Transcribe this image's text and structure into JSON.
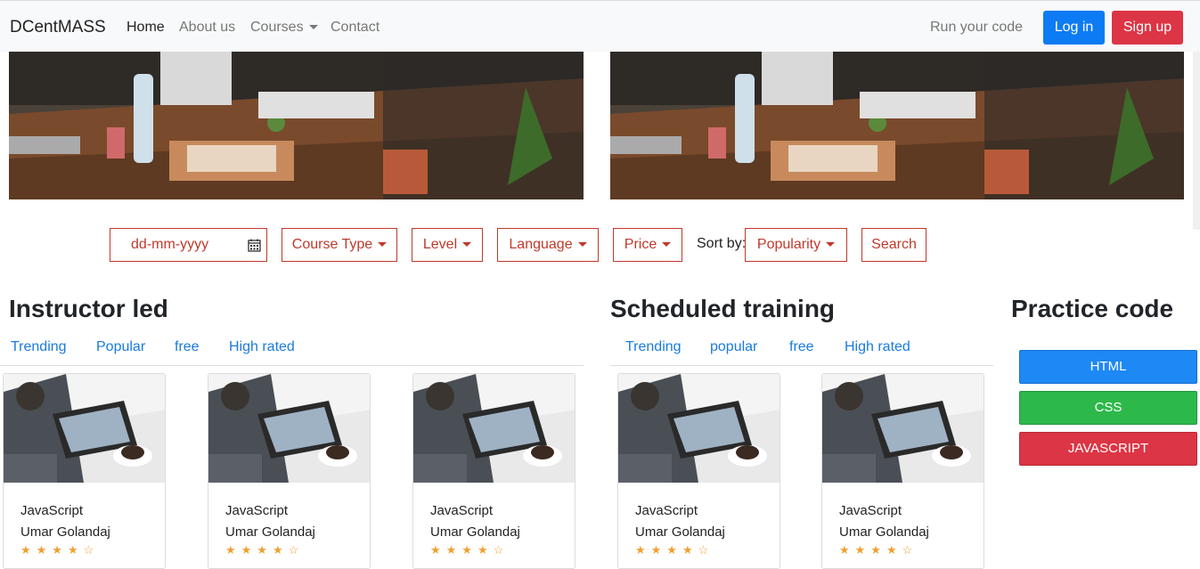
{
  "navbar": {
    "brand": "DCentMASS",
    "links": [
      {
        "label": "Home"
      },
      {
        "label": "About us"
      },
      {
        "label": "Courses"
      },
      {
        "label": "Contact"
      }
    ],
    "run_code": "Run your code",
    "login": "Log in",
    "signup": "Sign up"
  },
  "filters": {
    "date_placeholder": "dd-mm-yyyy",
    "course_type": "Course Type",
    "level": "Level",
    "language": "Language",
    "price": "Price",
    "sort_label": "Sort by:",
    "sort_value": "Popularity",
    "search": "Search"
  },
  "instructor": {
    "heading": "Instructor led",
    "tabs": [
      "Trending",
      "Popular",
      "free",
      "High rated"
    ],
    "cards": [
      {
        "title": "JavaScript",
        "author": "Umar Golandaj",
        "rating": 4
      },
      {
        "title": "JavaScript",
        "author": "Umar Golandaj",
        "rating": 4
      },
      {
        "title": "JavaScript",
        "author": "Umar Golandaj",
        "rating": 4
      }
    ]
  },
  "scheduled": {
    "heading": "Scheduled training",
    "tabs": [
      "Trending",
      "popular",
      "free",
      "High rated"
    ],
    "cards": [
      {
        "title": "JavaScript",
        "author": "Umar Golandaj",
        "rating": 4
      },
      {
        "title": "JavaScript",
        "author": "Umar Golandaj",
        "rating": 4
      }
    ]
  },
  "practice": {
    "heading": "Practice code",
    "buttons": [
      {
        "label": "HTML",
        "color": "#1e88f5"
      },
      {
        "label": "CSS",
        "color": "#2db84a"
      },
      {
        "label": "JAVASCRIPT",
        "color": "#dc3545"
      }
    ]
  }
}
